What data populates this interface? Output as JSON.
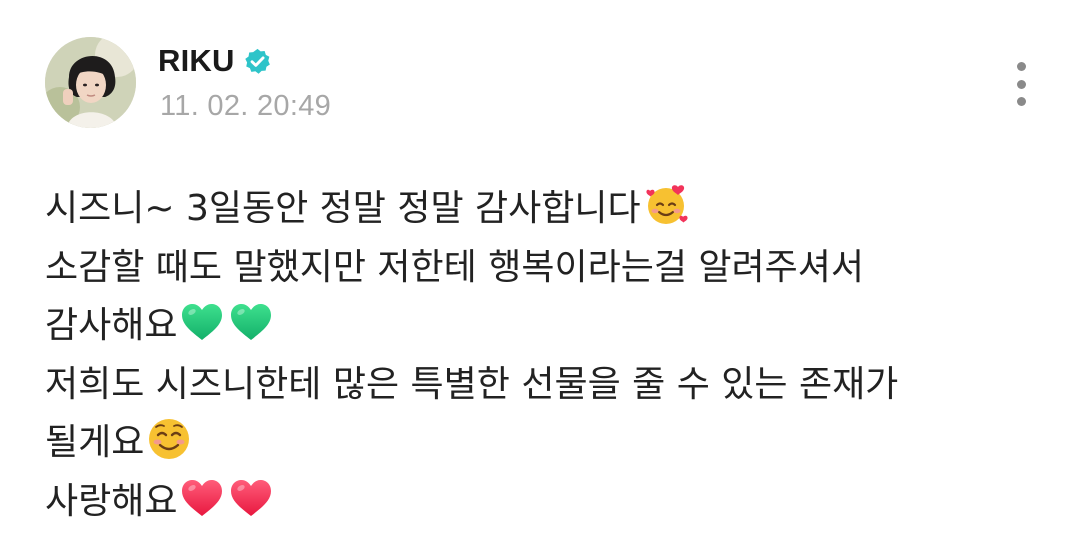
{
  "author": {
    "name": "RIKU",
    "verified": true,
    "verified_color": "#2ec4c9",
    "avatar_icon": "profile-photo-avatar"
  },
  "timestamp": "11. 02. 20:49",
  "menu": {
    "icon": "more-vertical-icon"
  },
  "post": {
    "lines": [
      {
        "text": "시즈니~ 3일동안 정말 정말 감사합니다",
        "emojis": [
          "smiling-face-with-hearts"
        ]
      },
      {
        "text": "소감할 때도 말했지만 저한테 행복이라는걸 알려주셔서",
        "emojis": []
      },
      {
        "text": "감사해요",
        "emojis": [
          "green-heart",
          "green-heart"
        ]
      },
      {
        "text": "저희도 시즈니한테 많은 특별한 선물을 줄 수 있는 존재가",
        "emojis": []
      },
      {
        "text": "될게요",
        "emojis": [
          "smiling-face"
        ]
      },
      {
        "text": "사랑해요",
        "emojis": [
          "red-heart",
          "red-heart"
        ]
      }
    ]
  },
  "colors": {
    "name_text": "#1a1a1a",
    "timestamp_text": "#a7a7a7",
    "body_text": "#222222",
    "menu_dots": "#8a8a8a"
  }
}
